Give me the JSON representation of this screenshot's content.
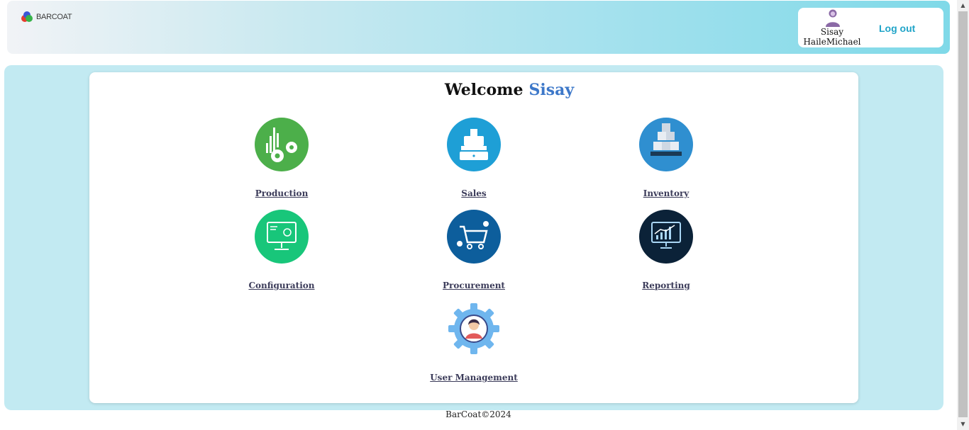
{
  "header": {
    "logo_text": "BARCOAT",
    "user": {
      "first_name": "Sisay",
      "last_name": "HaileMichael"
    },
    "logout_label": "Log out"
  },
  "main": {
    "welcome": {
      "greeting": "Welcome",
      "name": "Sisay"
    },
    "modules": [
      {
        "label": "Production",
        "icon": "production-gears-icon",
        "color": "#4caf4a"
      },
      {
        "label": "Sales",
        "icon": "cash-register-icon",
        "color": "#1e9fd6"
      },
      {
        "label": "Inventory",
        "icon": "inventory-boxes-icon",
        "color": "#2f8fd0"
      },
      {
        "label": "Configuration",
        "icon": "configuration-monitor-icon",
        "color": "#18c67a"
      },
      {
        "label": "Procurement",
        "icon": "shopping-cart-icon",
        "color": "#0d5e9c"
      },
      {
        "label": "Reporting",
        "icon": "reporting-chart-icon",
        "color": "#0b2238"
      },
      {
        "label": "User Management",
        "icon": "user-management-gear-icon",
        "color": "#6fb6ee"
      }
    ]
  },
  "footer": {
    "text": "BarCoat©2024"
  }
}
